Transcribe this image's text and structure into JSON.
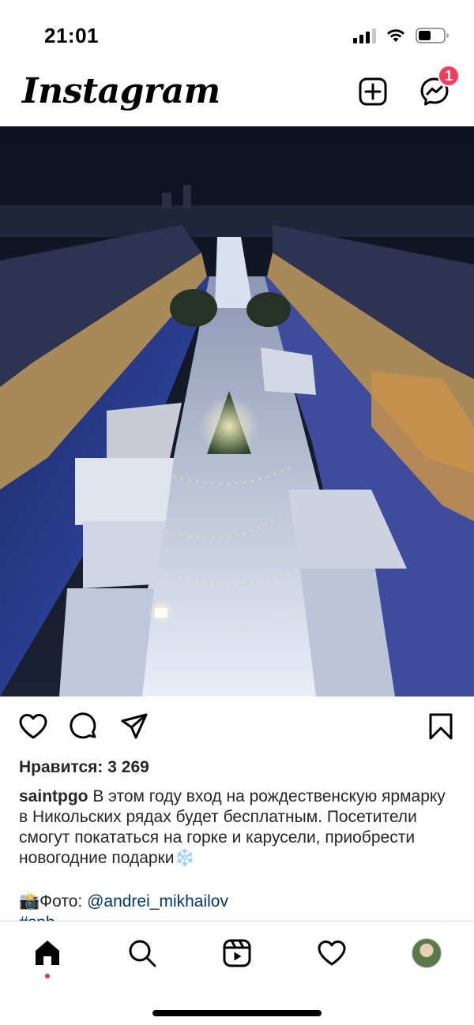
{
  "status_bar": {
    "time": "21:01"
  },
  "header": {
    "logo": "Instagram",
    "icons": [
      "new-post-icon",
      "messenger-icon"
    ],
    "messenger_badge": "1"
  },
  "post": {
    "image_description_icon": "photo",
    "actions": [
      "heart-icon",
      "comment-icon",
      "share-icon",
      "bookmark-icon"
    ],
    "likes_text": "Нравится: 3 269",
    "author": "saintpgo",
    "caption_text": "В этом году вход на рождественскую ярмарку в Никольских рядах будет бесплатным. Посетители смогут покататься на горке и карусели, приобрести новогодние подарки",
    "caption_emoji": "❄️",
    "credit_emoji": "📸",
    "credit_label": "Фото: ",
    "credit_link": "@andrei_mikhailov",
    "hashtag_peek": "#spb"
  },
  "bottom_nav": {
    "items": [
      "home-icon",
      "search-icon",
      "reels-icon",
      "activity-heart-icon",
      "profile-avatar"
    ]
  },
  "colors": {
    "badge": "#ff3b5c",
    "link": "#00376b",
    "nav_dot": "#ff3040"
  }
}
